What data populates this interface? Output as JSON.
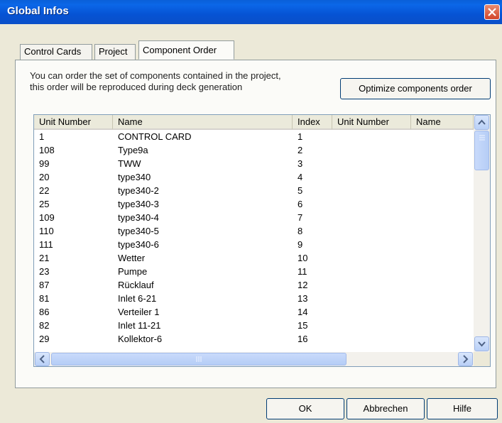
{
  "window": {
    "title": "Global Infos"
  },
  "tabs": [
    {
      "label": "Control Cards",
      "active": false
    },
    {
      "label": "Project",
      "active": false
    },
    {
      "label": "Component Order",
      "active": true
    }
  ],
  "description": {
    "line1": "You can order the set of components contained in the project,",
    "line2": "this order will be reproduced during deck generation"
  },
  "optimize_button": "Optimize components order",
  "list": {
    "columns": [
      "Unit Number",
      "Name",
      "Index",
      "Unit Number",
      "Name"
    ],
    "rows": [
      {
        "unit": "1",
        "name": "CONTROL CARD",
        "index": "1"
      },
      {
        "unit": "108",
        "name": "Type9a",
        "index": "2"
      },
      {
        "unit": "99",
        "name": "TWW",
        "index": "3"
      },
      {
        "unit": "20",
        "name": "type340",
        "index": "4"
      },
      {
        "unit": "22",
        "name": "type340-2",
        "index": "5"
      },
      {
        "unit": "25",
        "name": "type340-3",
        "index": "6"
      },
      {
        "unit": "109",
        "name": "type340-4",
        "index": "7"
      },
      {
        "unit": "110",
        "name": "type340-5",
        "index": "8"
      },
      {
        "unit": "111",
        "name": "type340-6",
        "index": "9"
      },
      {
        "unit": "21",
        "name": "Wetter",
        "index": "10"
      },
      {
        "unit": "23",
        "name": "Pumpe",
        "index": "11"
      },
      {
        "unit": "87",
        "name": "Rücklauf",
        "index": "12"
      },
      {
        "unit": "81",
        "name": "Inlet 6-21",
        "index": "13"
      },
      {
        "unit": "86",
        "name": "Verteiler 1",
        "index": "14"
      },
      {
        "unit": "82",
        "name": "Inlet 11-21",
        "index": "15"
      },
      {
        "unit": "29",
        "name": "Kollektor-6",
        "index": "16"
      }
    ]
  },
  "footer": {
    "ok": "OK",
    "cancel": "Abbrechen",
    "help": "Hilfe"
  },
  "colors": {
    "title_bar": "#0a5fd8",
    "dialog_bg": "#ece9d8",
    "close_button": "#d2452a",
    "scrollbar": "#b9d0f7"
  },
  "icons": [
    "close-icon",
    "scroll-up-arrow-icon",
    "scroll-down-arrow-icon",
    "scroll-left-arrow-icon",
    "scroll-right-arrow-icon"
  ]
}
